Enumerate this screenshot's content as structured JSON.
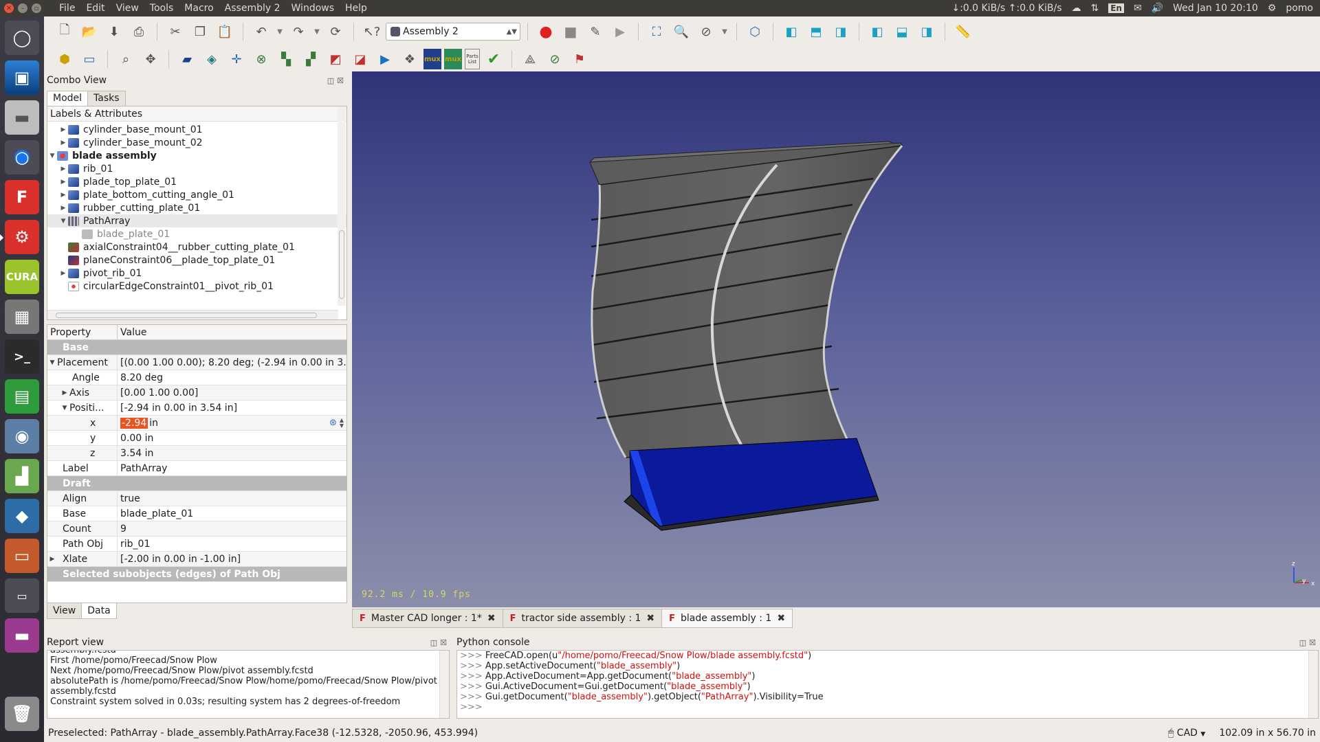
{
  "menubar": {
    "items": [
      "File",
      "Edit",
      "View",
      "Tools",
      "Macro",
      "Assembly 2",
      "Windows",
      "Help"
    ]
  },
  "tray": {
    "net": "↓:0.0 KiB/s ↑:0.0 KiB/s",
    "lang": "En",
    "datetime": "Wed Jan 10 20:10",
    "user": "pomo"
  },
  "launcher": {
    "cura_label": "CURA"
  },
  "toolbar": {
    "document_select": "Assembly 2",
    "assembly_tool_labels": {
      "mux1": "mux",
      "mux2": "mux",
      "partslist": "Parts List"
    }
  },
  "combo_view": {
    "title": "Combo View",
    "tabs": [
      "Model",
      "Tasks"
    ],
    "tree_header": "Labels & Attributes",
    "tree": [
      {
        "label": "cylinder_base_mount_01"
      },
      {
        "label": "cylinder_base_mount_02"
      },
      {
        "label": "blade assembly"
      },
      {
        "label": "rib_01"
      },
      {
        "label": "plade_top_plate_01"
      },
      {
        "label": "plate_bottom_cutting_angle_01"
      },
      {
        "label": "rubber_cutting_plate_01"
      },
      {
        "label": "PathArray"
      },
      {
        "label": "blade_plate_01"
      },
      {
        "label": "axialConstraint04__rubber_cutting_plate_01"
      },
      {
        "label": "planeConstraint06__plade_top_plate_01"
      },
      {
        "label": "pivot_rib_01"
      },
      {
        "label": "circularEdgeConstraint01__pivot_rib_01"
      }
    ],
    "property_header": {
      "property": "Property",
      "value": "Value"
    },
    "properties": {
      "group_base": "Base",
      "placement": {
        "name": "Placement",
        "value": "[(0.00 1.00 0.00); 8.20 deg; (-2.94 in  0.00 in  3...."
      },
      "angle": {
        "name": "Angle",
        "value": "8.20 deg"
      },
      "axis": {
        "name": "Axis",
        "value": "[0.00 1.00 0.00]"
      },
      "position": {
        "name": "Positi...",
        "value": "[-2.94 in  0.00 in  3.54 in]"
      },
      "x": {
        "name": "x",
        "value": "-2.94",
        "unit": "in"
      },
      "y": {
        "name": "y",
        "value": "0.00 in"
      },
      "z": {
        "name": "z",
        "value": "3.54 in"
      },
      "label": {
        "name": "Label",
        "value": "PathArray"
      },
      "group_draft": "Draft",
      "align": {
        "name": "Align",
        "value": "true"
      },
      "base": {
        "name": "Base",
        "value": "blade_plate_01"
      },
      "count": {
        "name": "Count",
        "value": "9"
      },
      "pathobj": {
        "name": "Path Obj",
        "value": "rib_01"
      },
      "xlate": {
        "name": "Xlate",
        "value": "[-2.00 in  0.00 in  -1.00 in]"
      },
      "group_sub": "Selected subobjects (edges) of  Path Obj"
    },
    "bottom_tabs": [
      "View",
      "Data"
    ]
  },
  "viewport": {
    "fps": "92.2 ms / 10.9 fps",
    "axis_labels": {
      "z": "z",
      "y": "y",
      "x": "x"
    }
  },
  "doc_tabs": [
    {
      "label": "Master CAD longer : 1*"
    },
    {
      "label": "tractor side assembly : 1"
    },
    {
      "label": "blade assembly : 1"
    }
  ],
  "report_view": {
    "title": "Report view",
    "lines": [
      "assembly.fcstd",
      "First /home/pomo/Freecad/Snow Plow",
      "Next /home/pomo/Freecad/Snow Plow/pivot assembly.fcstd",
      "absolutePath is /home/pomo/Freecad/Snow Plow/home/pomo/Freecad/Snow Plow/pivot",
      "assembly.fcstd",
      "Constraint system solved in 0.03s; resulting system has 2 degrees-of-freedom"
    ]
  },
  "python_console": {
    "title": "Python console",
    "prompt": ">>>",
    "lines": [
      {
        "a": "FreeCAD.open(u",
        "s": "\"/home/pomo/Freecad/Snow Plow/blade assembly.fcstd\"",
        "b": ")"
      },
      {
        "a": "App.setActiveDocument(",
        "s": "\"blade_assembly\"",
        "b": ")"
      },
      {
        "a": "App.ActiveDocument=App.getDocument(",
        "s": "\"blade_assembly\"",
        "b": ")"
      },
      {
        "a": "Gui.ActiveDocument=Gui.getDocument(",
        "s": "\"blade_assembly\"",
        "b": ")"
      },
      {
        "a": "Gui.getDocument(",
        "s": "\"blade_assembly\"",
        "b": ").getObject(",
        "s2": "\"PathArray\"",
        "c": ").Visibility=True"
      }
    ]
  },
  "statusbar": {
    "message": "Preselected: PathArray - blade_assembly.PathArray.Face38 (-12.5328, -2050.96, 453.994)",
    "nav_style": "CAD",
    "dimensions": "102.09 in x 56.70 in"
  },
  "colors": {
    "accent": "#e95420",
    "viewport_top": "#2f3479",
    "viewport_bottom": "#8b8eaa",
    "blade_plate": "#5f5f5f",
    "cutting_plate": "#0a1a9a"
  }
}
